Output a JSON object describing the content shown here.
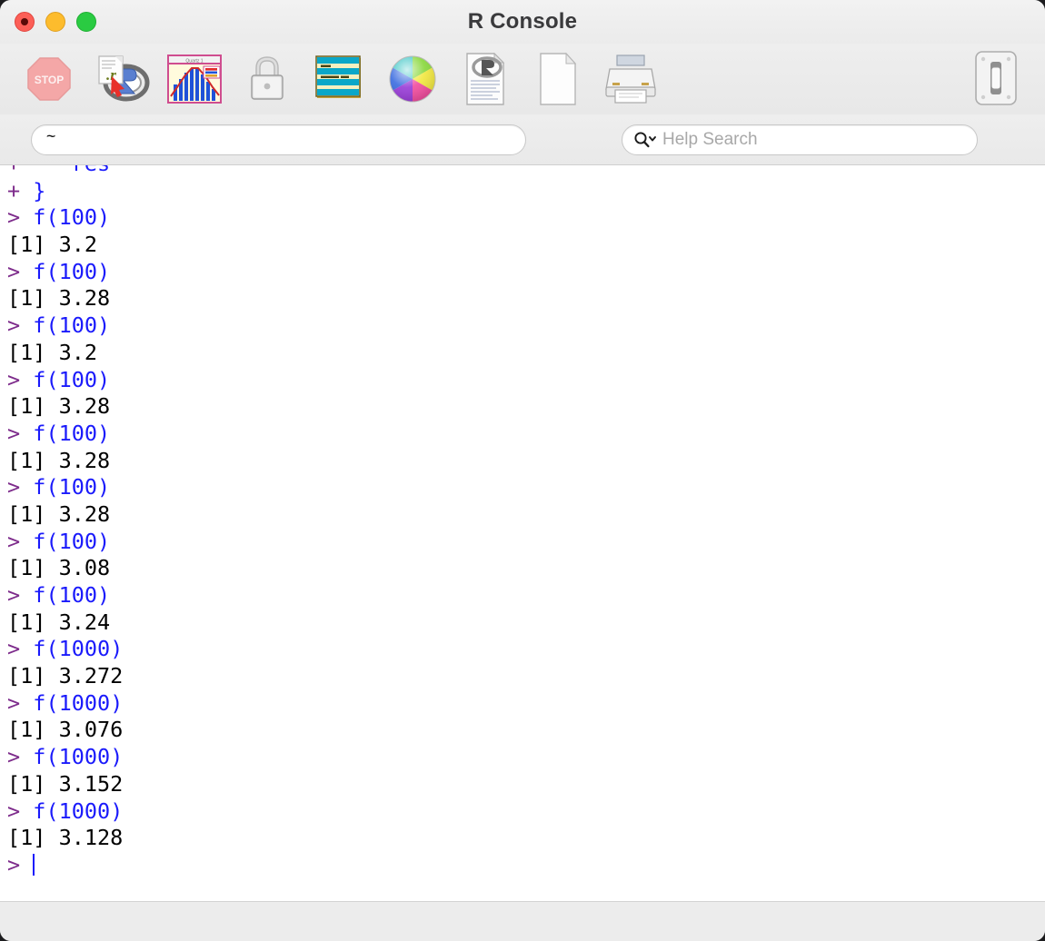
{
  "window": {
    "title": "R Console",
    "traffic_lights": [
      {
        "name": "close",
        "color": "#fc5f57"
      },
      {
        "name": "minimize",
        "color": "#fdbc2d"
      },
      {
        "name": "zoom",
        "color": "#2acb42"
      }
    ]
  },
  "toolbar": {
    "buttons": [
      {
        "name": "stop-button",
        "icon": "stop-icon",
        "label": "Stop"
      },
      {
        "name": "source-script-button",
        "icon": "r-script-icon",
        "label": "Source Script"
      },
      {
        "name": "quartz-plot-button",
        "icon": "quartz-plot-icon",
        "label": "Quartz"
      },
      {
        "name": "lock-button",
        "icon": "padlock-icon",
        "label": "Lock"
      },
      {
        "name": "history-button",
        "icon": "history-stripes-icon",
        "label": "History"
      },
      {
        "name": "color-picker-button",
        "icon": "color-wheel-icon",
        "label": "Colors"
      },
      {
        "name": "r-document-button",
        "icon": "r-document-icon",
        "label": "R Document"
      },
      {
        "name": "new-document-button",
        "icon": "blank-page-icon",
        "label": "New Document"
      },
      {
        "name": "print-button",
        "icon": "printer-icon",
        "label": "Print"
      }
    ],
    "right_button": {
      "name": "toggle-switch-button",
      "icon": "toggle-switch-icon",
      "label": "Toggle"
    }
  },
  "locationbar": {
    "path_value": "~",
    "path_placeholder": "",
    "help_search_placeholder": "Help Search",
    "help_search_value": "",
    "search_icon": "magnifier-with-chevron-icon"
  },
  "console": {
    "colors": {
      "prompt": "#7d2b8b",
      "command": "#1a1afb",
      "output": "#000000",
      "background": "#ffffff"
    },
    "lines": [
      {
        "type": "continuation",
        "prompt": "+",
        "text": "    res"
      },
      {
        "type": "continuation",
        "prompt": "+",
        "text": " }"
      },
      {
        "type": "command",
        "prompt": ">",
        "text": " f(100)"
      },
      {
        "type": "output",
        "prompt": "",
        "text": "[1] 3.2"
      },
      {
        "type": "command",
        "prompt": ">",
        "text": " f(100)"
      },
      {
        "type": "output",
        "prompt": "",
        "text": "[1] 3.28"
      },
      {
        "type": "command",
        "prompt": ">",
        "text": " f(100)"
      },
      {
        "type": "output",
        "prompt": "",
        "text": "[1] 3.2"
      },
      {
        "type": "command",
        "prompt": ">",
        "text": " f(100)"
      },
      {
        "type": "output",
        "prompt": "",
        "text": "[1] 3.28"
      },
      {
        "type": "command",
        "prompt": ">",
        "text": " f(100)"
      },
      {
        "type": "output",
        "prompt": "",
        "text": "[1] 3.28"
      },
      {
        "type": "command",
        "prompt": ">",
        "text": " f(100)"
      },
      {
        "type": "output",
        "prompt": "",
        "text": "[1] 3.28"
      },
      {
        "type": "command",
        "prompt": ">",
        "text": " f(100)"
      },
      {
        "type": "output",
        "prompt": "",
        "text": "[1] 3.08"
      },
      {
        "type": "command",
        "prompt": ">",
        "text": " f(100)"
      },
      {
        "type": "output",
        "prompt": "",
        "text": "[1] 3.24"
      },
      {
        "type": "command",
        "prompt": ">",
        "text": " f(1000)"
      },
      {
        "type": "output",
        "prompt": "",
        "text": "[1] 3.272"
      },
      {
        "type": "command",
        "prompt": ">",
        "text": " f(1000)"
      },
      {
        "type": "output",
        "prompt": "",
        "text": "[1] 3.076"
      },
      {
        "type": "command",
        "prompt": ">",
        "text": " f(1000)"
      },
      {
        "type": "output",
        "prompt": "",
        "text": "[1] 3.152"
      },
      {
        "type": "command",
        "prompt": ">",
        "text": " f(1000)"
      },
      {
        "type": "output",
        "prompt": "",
        "text": "[1] 3.128"
      },
      {
        "type": "cursor",
        "prompt": ">",
        "text": " "
      }
    ]
  },
  "statusbar": {
    "text": ""
  }
}
